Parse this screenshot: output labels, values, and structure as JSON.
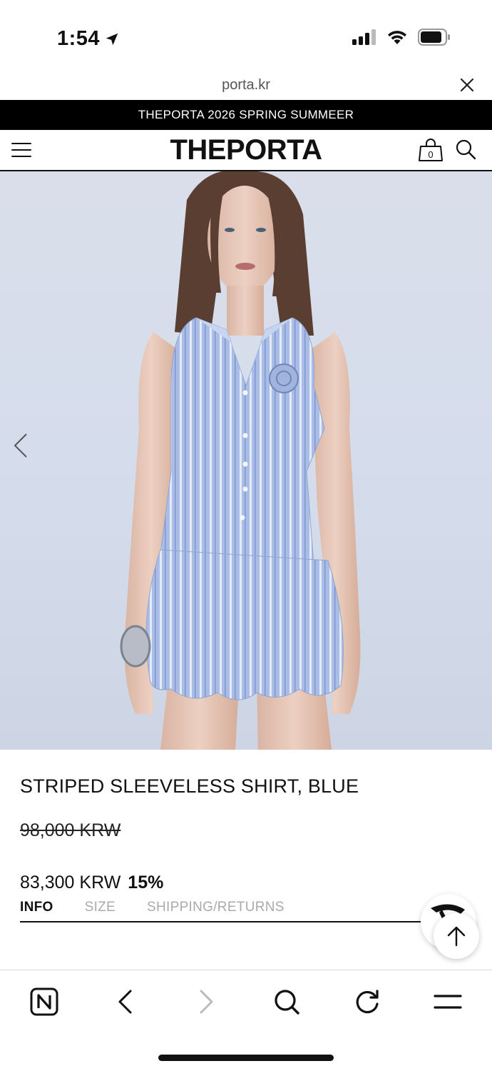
{
  "status_bar": {
    "time": "1:54"
  },
  "browser": {
    "url": "porta.kr"
  },
  "promo_banner": {
    "text": "THEPORTA 2026 SPRING SUMMEER"
  },
  "header": {
    "brand": "THEPORTA",
    "cart_count": "0"
  },
  "product": {
    "name": "STRIPED SLEEVELESS SHIRT, BLUE",
    "original_price": "98,000 KRW",
    "sale_price": "83,300 KRW",
    "discount": "15%"
  },
  "tabs": [
    {
      "label": "INFO",
      "active": true
    },
    {
      "label": "SIZE",
      "active": false
    },
    {
      "label": "SHIPPING/RETURNS",
      "active": false
    }
  ],
  "icons": {
    "location": "location-arrow-icon",
    "signal": "cellular-signal-icon",
    "wifi": "wifi-icon",
    "battery": "battery-icon",
    "close": "close-icon",
    "menu": "hamburger-menu-icon",
    "bag": "shopping-bag-icon",
    "search": "search-icon",
    "prev": "chevron-left-icon",
    "scroll_top": "arrow-up-icon",
    "naver": "naver-n-icon",
    "back": "back-arrow-icon",
    "forward": "forward-arrow-icon",
    "refresh": "refresh-icon",
    "more": "more-menu-icon"
  },
  "colors": {
    "banner_bg": "#000000",
    "hero_bg": "#d6dced",
    "muted_tab": "#aaaaaa"
  }
}
